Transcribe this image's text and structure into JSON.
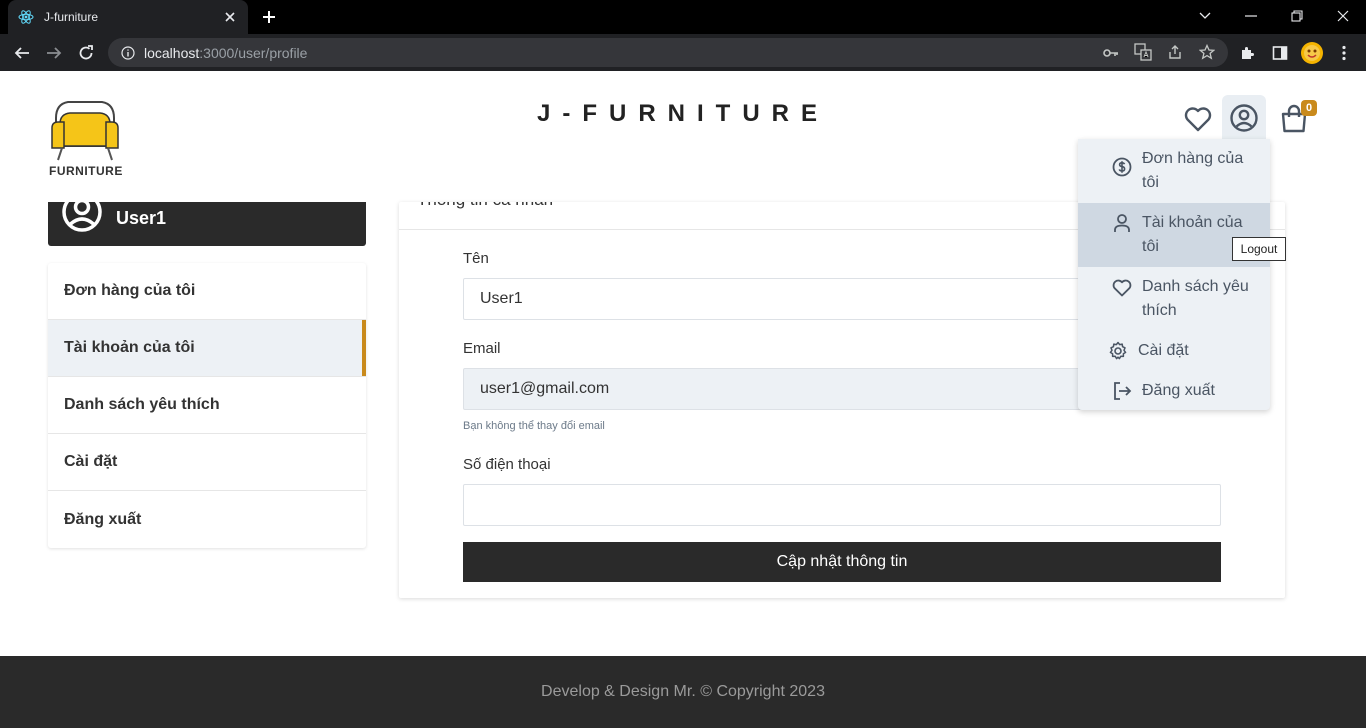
{
  "browser": {
    "tab_title": "J-furniture",
    "url_host": "localhost",
    "url_path": ":3000/user/profile"
  },
  "header": {
    "brand": "J-FURNITURE",
    "logo_text": "FURNITURE",
    "cart_count": "0"
  },
  "sidebar": {
    "user_name": "User1",
    "items": [
      {
        "label": "Đơn hàng của tôi"
      },
      {
        "label": "Tài khoản của tôi"
      },
      {
        "label": "Danh sách yêu thích"
      },
      {
        "label": "Cài đặt"
      },
      {
        "label": "Đăng xuất"
      }
    ]
  },
  "profile": {
    "title": "Thông tin cá nhân",
    "name_label": "Tên",
    "name_value": "User1",
    "email_label": "Email",
    "email_value": "user1@gmail.com",
    "email_help": "Bạn không thể thay đổi email",
    "phone_label": "Số điện thoại",
    "phone_value": "",
    "submit_label": "Cập nhật thông tin"
  },
  "dropdown": {
    "items": [
      {
        "label": "Đơn hàng của tôi",
        "icon": "dollar-circle-icon"
      },
      {
        "label": "Tài khoản của tôi",
        "icon": "user-icon"
      },
      {
        "label": "Danh sách yêu thích",
        "icon": "heart-icon"
      },
      {
        "label": "Cài đặt",
        "icon": "gear-icon"
      },
      {
        "label": "Đăng xuất",
        "icon": "logout-icon"
      }
    ],
    "tooltip": "Logout"
  },
  "footer": {
    "text": "Develop & Design Mr. © Copyright 2023"
  },
  "colors": {
    "accent": "#c98a1c",
    "dark": "#2a2a2a",
    "light_bg": "#edf1f5",
    "logo_yellow": "#f5c518"
  }
}
